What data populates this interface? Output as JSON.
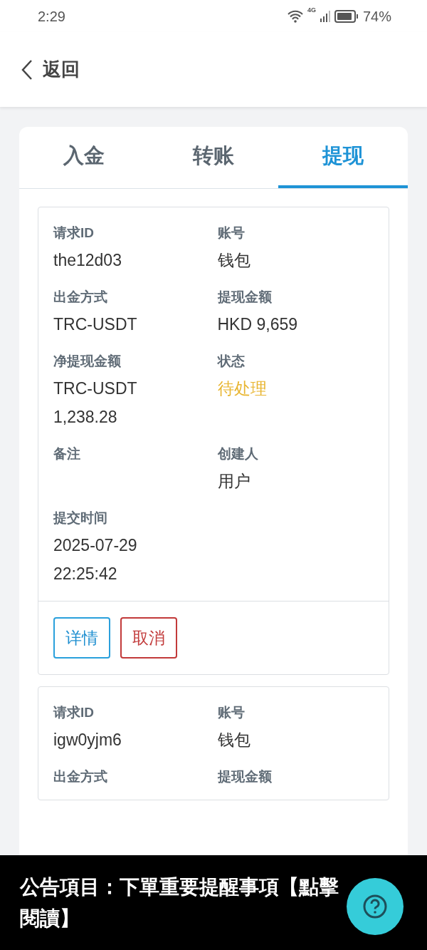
{
  "status_bar": {
    "time": "2:29",
    "battery": "74%",
    "network": "4G"
  },
  "header": {
    "back": "返回"
  },
  "tabs": [
    {
      "label": "入金",
      "selected": false
    },
    {
      "label": "转账",
      "selected": false
    },
    {
      "label": "提现",
      "selected": true
    }
  ],
  "records": [
    {
      "fields": [
        {
          "label": "请求ID",
          "value": [
            "the12d03"
          ],
          "kind": "text"
        },
        {
          "label": "账号",
          "value": [
            "钱包"
          ],
          "kind": "text"
        },
        {
          "label": "出金方式",
          "value": [
            "TRC-USDT"
          ],
          "kind": "text"
        },
        {
          "label": "提现金额",
          "value": [
            "HKD 9,659"
          ],
          "kind": "text"
        },
        {
          "label": "净提现金额",
          "value": [
            "TRC-USDT",
            "1,238.28"
          ],
          "kind": "text"
        },
        {
          "label": "状态",
          "value": [
            "待处理"
          ],
          "kind": "status"
        },
        {
          "label": "备注",
          "kind": "text"
        },
        {
          "label": "创建人",
          "value": [
            "用户"
          ],
          "kind": "text"
        },
        {
          "label": "提交时间",
          "value": [
            "2025-07-29",
            "22:25:42"
          ],
          "kind": "text"
        }
      ],
      "actions": [
        {
          "label": "详情",
          "kind": "primary"
        },
        {
          "label": "取消",
          "kind": "danger"
        }
      ]
    },
    {
      "fields": [
        {
          "label": "请求ID",
          "value": [
            "igw0yjm6"
          ],
          "kind": "text"
        },
        {
          "label": "账号",
          "value": [
            "钱包"
          ],
          "kind": "text"
        },
        {
          "label": "出金方式",
          "kind": "text"
        },
        {
          "label": "提现金额",
          "kind": "text"
        }
      ]
    }
  ],
  "announcement": {
    "text": "公告項目：下單重要提醒事項【點擊閱讀】"
  }
}
